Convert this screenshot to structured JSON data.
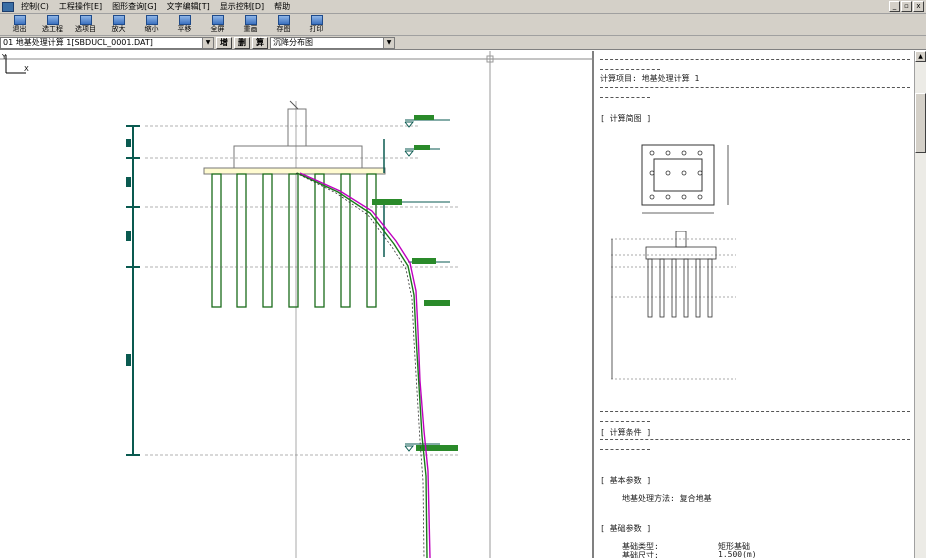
{
  "menubar": {
    "items": [
      "控制(C)",
      "工程操作[E]",
      "图形查询[G]",
      "文字编辑[T]",
      "显示控制[D]",
      "帮助"
    ],
    "window_buttons": [
      "_",
      "▫",
      "x"
    ]
  },
  "toolbar": {
    "buttons": [
      {
        "label": "退出",
        "icon": "exit-icon"
      },
      {
        "label": "选工程",
        "icon": "select-project-icon"
      },
      {
        "label": "选项目",
        "icon": "select-item-icon"
      },
      {
        "label": "放大",
        "icon": "zoom-in-icon"
      },
      {
        "label": "缩小",
        "icon": "zoom-out-icon"
      },
      {
        "label": "平移",
        "icon": "pan-icon"
      },
      {
        "label": "全屏",
        "icon": "fullscreen-icon"
      },
      {
        "label": "重画",
        "icon": "redraw-icon"
      },
      {
        "label": "存图",
        "icon": "save-image-icon"
      },
      {
        "label": "打印",
        "icon": "print-icon"
      }
    ]
  },
  "optbar": {
    "calc_select": "01 地基处理计算 1[SBDUCL_0001.DAT]",
    "btn_add": "增",
    "btn_delete": "删",
    "btn_calc": "算",
    "result_select": "沉降分布图"
  },
  "report": {
    "calc_item_line": "计算项目: 地基处理计算 1",
    "section_diagram": "[ 计算简图 ]",
    "section_conditions": "[ 计算条件 ]",
    "section_basic": "[ 基本参数 ]",
    "method_line": "地基处理方法: 复合地基",
    "section_foundation": "[ 基础参数 ]",
    "foundation_type_label": "基础类型:",
    "foundation_type_value": "矩形基础",
    "foundation_dim_label": "基础尺寸:",
    "foundation_dim_value": "1.500(m)"
  },
  "colors": {
    "pile": "#1a6b1a",
    "dim_line": "#0a5a50",
    "curve_magenta": "#c000c0",
    "curve_green": "#1a7a1a",
    "window_face": "#d4d0c8"
  }
}
